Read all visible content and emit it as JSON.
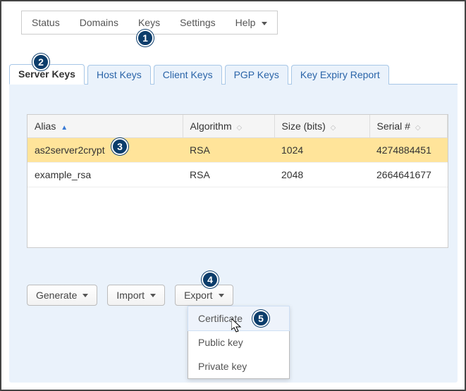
{
  "topnav": {
    "items": [
      {
        "label": "Status"
      },
      {
        "label": "Domains"
      },
      {
        "label": "Keys"
      },
      {
        "label": "Settings"
      },
      {
        "label": "Help"
      }
    ]
  },
  "tabs": [
    {
      "label": "Server Keys"
    },
    {
      "label": "Host Keys"
    },
    {
      "label": "Client Keys"
    },
    {
      "label": "PGP Keys"
    },
    {
      "label": "Key Expiry Report"
    }
  ],
  "table": {
    "columns": {
      "alias": "Alias",
      "algorithm": "Algorithm",
      "size": "Size (bits)",
      "serial": "Serial #"
    },
    "rows": [
      {
        "alias": "as2server2crypt",
        "algorithm": "RSA",
        "size": "1024",
        "serial": "4274884451"
      },
      {
        "alias": "example_rsa",
        "algorithm": "RSA",
        "size": "2048",
        "serial": "2664641677"
      }
    ]
  },
  "actions": {
    "generate": "Generate",
    "import": "Import",
    "export": "Export"
  },
  "exportMenu": {
    "certificate": "Certificate",
    "public_key": "Public key",
    "private_key": "Private key"
  },
  "badges": {
    "b1": "1",
    "b2": "2",
    "b3": "3",
    "b4": "4",
    "b5": "5"
  },
  "colors": {
    "accent_blue": "#2a64a8",
    "tab_bg": "#eaf2fb",
    "badge_bg": "#0c3d6b",
    "row_selected": "#ffe49a"
  }
}
